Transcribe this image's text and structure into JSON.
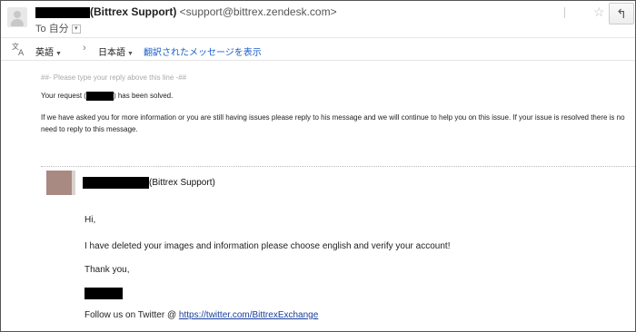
{
  "header": {
    "sender_name": "(Bittrex Support)",
    "sender_email": "<support@bittrex.zendesk.com>",
    "to_prefix": "To",
    "to_name": "自分",
    "caret": "▾"
  },
  "translate": {
    "source_lang": "英語",
    "target_lang": "日本語",
    "link": "翻訳されたメッセージを表示",
    "dropdown_glyph": "▼",
    "arrow_glyph": "›"
  },
  "ticket": {
    "separator": "##- Please type your reply above this line -##",
    "request_prefix": "Your request (",
    "request_suffix": ") has been solved.",
    "info": "If we have asked you for more information or you are still having issues please reply to his message and we will continue to help you on this issue. If your issue is resolved there is no need to reply to this message."
  },
  "agent": {
    "name_suffix": "(Bittrex Support)"
  },
  "message": {
    "greeting": "Hi,",
    "body": "I have deleted your images and information please choose english and verify your account!",
    "thanks": "Thank you,",
    "follow_prefix": "Follow us on Twitter @ ",
    "twitter_url": "https://twitter.com/BittrexExchange"
  },
  "icons": {
    "star": "☆",
    "reply": "↰"
  }
}
